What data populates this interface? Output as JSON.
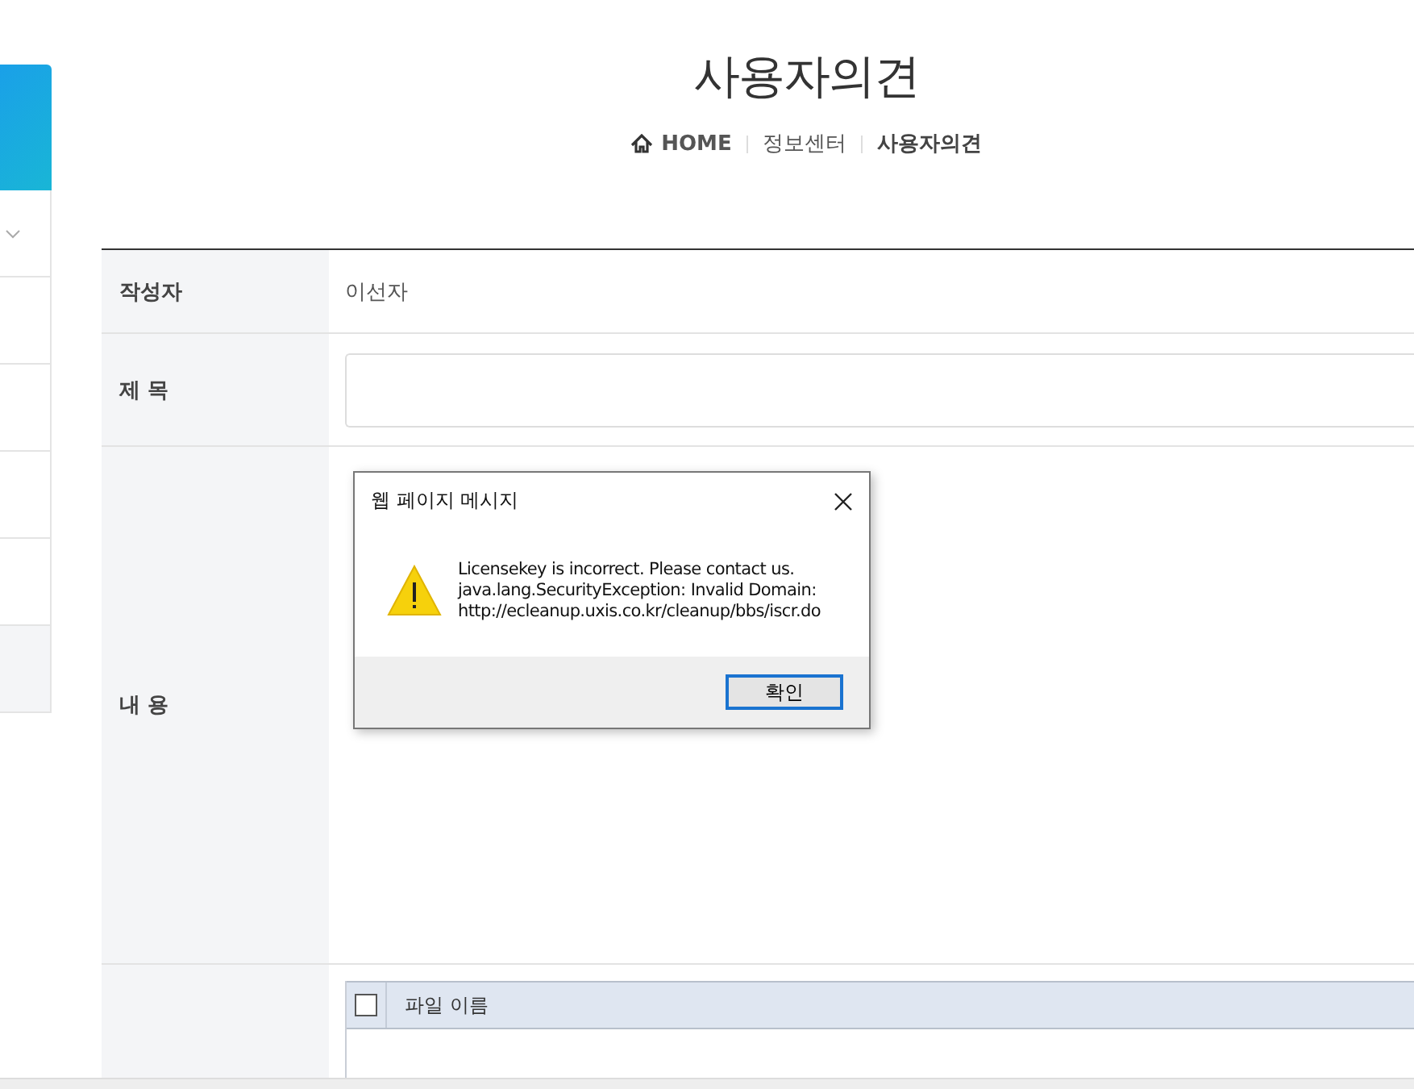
{
  "sidebar": {
    "items": [
      {
        "kind": "dropdown"
      },
      {
        "kind": "link"
      },
      {
        "kind": "link"
      },
      {
        "kind": "link"
      },
      {
        "kind": "link"
      },
      {
        "kind": "shaded"
      }
    ]
  },
  "page": {
    "title": "사용자의견",
    "breadcrumb": [
      "HOME",
      "정보센터",
      "사용자의견"
    ]
  },
  "form": {
    "author_label": "작성자",
    "author": "이선자",
    "subject_label": "제 목",
    "content_label": "내 용"
  },
  "file_table": {
    "checked": false,
    "column": "파일 이름"
  },
  "dialog": {
    "title": "웹 페이지 메시지",
    "lines": [
      "Licensekey is incorrect. Please contact us.",
      "java.lang.SecurityException: Invalid Domain:",
      "http://ecleanup.uxis.co.kr/cleanup/bbs/iscr.do"
    ],
    "button": "확인"
  }
}
